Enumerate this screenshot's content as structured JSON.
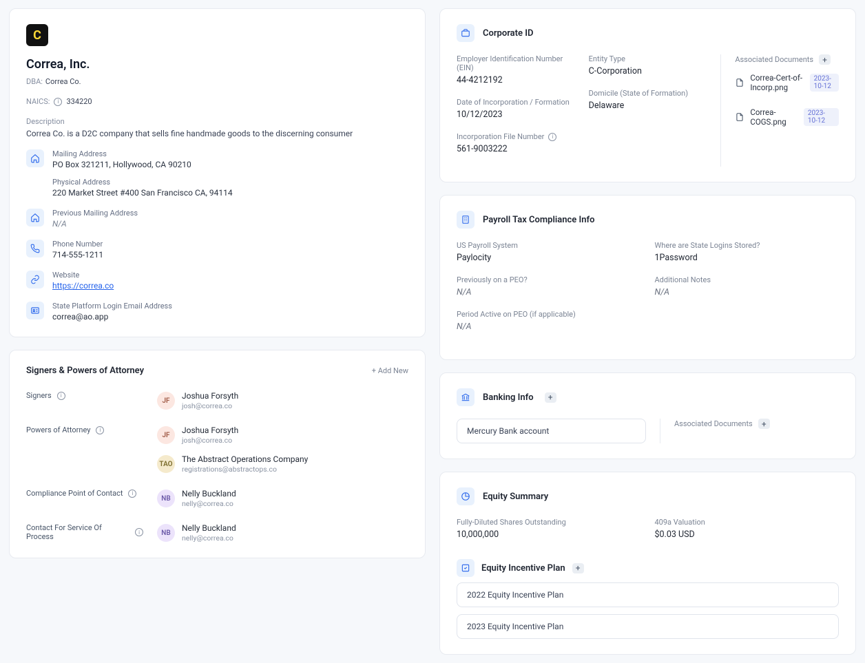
{
  "company": {
    "name": "Correa, Inc.",
    "dba_label": "DBA:",
    "dba_value": "Correa Co.",
    "naics_label": "NAICS:",
    "naics_value": "334220",
    "description_label": "Description",
    "description": "Correa Co. is a D2C company that sells fine handmade goods to the discerning consumer",
    "mailing": {
      "label": "Mailing Address",
      "value": "PO Box 321211, Hollywood, CA 90210"
    },
    "physical": {
      "label": "Physical Address",
      "value": "220 Market Street #400 San Francisco CA, 94114"
    },
    "prev_mailing": {
      "label": "Previous Mailing Address",
      "value": "N/A"
    },
    "phone": {
      "label": "Phone Number",
      "value": "714-555-1211"
    },
    "website": {
      "label": "Website",
      "value": "https://correa.co"
    },
    "login_email": {
      "label": "State Platform Login Email Address",
      "value": "correa@ao.app"
    }
  },
  "signers": {
    "title": "Signers & Powers of Attorney",
    "add_new": "+ Add New",
    "groups": [
      {
        "label": "Signers",
        "people": [
          {
            "initials": "JF",
            "color": "pink",
            "name": "Joshua Forsyth",
            "email": "josh@correa.co"
          }
        ]
      },
      {
        "label": "Powers of Attorney",
        "people": [
          {
            "initials": "JF",
            "color": "pink",
            "name": "Joshua Forsyth",
            "email": "josh@correa.co"
          },
          {
            "initials": "TAO",
            "color": "yellow",
            "name": "The Abstract Operations Company",
            "email": "registrations@abstractops.co"
          }
        ]
      },
      {
        "label": "Compliance Point of Contact",
        "people": [
          {
            "initials": "NB",
            "color": "purple",
            "name": "Nelly Buckland",
            "email": "nelly@correa.co"
          }
        ]
      },
      {
        "label": "Contact For Service Of Process",
        "people": [
          {
            "initials": "NB",
            "color": "purple",
            "name": "Nelly Buckland",
            "email": "nelly@correa.co"
          }
        ]
      }
    ]
  },
  "corporate": {
    "title": "Corporate ID",
    "ein": {
      "label": "Employer Identification Number (EIN)",
      "value": "44-4212192"
    },
    "entity": {
      "label": "Entity Type",
      "value": "C-Corporation"
    },
    "incorp_date": {
      "label": "Date of Incorporation / Formation",
      "value": "10/12/2023"
    },
    "domicile": {
      "label": "Domicile (State of Formation)",
      "value": "Delaware"
    },
    "file_no": {
      "label": "Incorporation File Number",
      "value": "561-9003222"
    },
    "assoc_label": "Associated Documents",
    "docs": [
      {
        "name": "Correa-Cert-of-Incorp.png",
        "date": "2023-10-12"
      },
      {
        "name": "Correa-COGS.png",
        "date": "2023-10-12"
      }
    ]
  },
  "payroll": {
    "title": "Payroll Tax Compliance Info",
    "system": {
      "label": "US Payroll System",
      "value": "Paylocity"
    },
    "logins": {
      "label": "Where are State Logins Stored?",
      "value": "1Password"
    },
    "peo": {
      "label": "Previously on a PEO?",
      "value": "N/A"
    },
    "notes": {
      "label": "Additional Notes",
      "value": "N/A"
    },
    "period": {
      "label": "Period Active on PEO (if applicable)",
      "value": "N/A"
    }
  },
  "banking": {
    "title": "Banking Info",
    "account": "Mercury Bank account",
    "assoc_label": "Associated Documents"
  },
  "equity": {
    "title": "Equity Summary",
    "shares": {
      "label": "Fully-Diluted Shares Outstanding",
      "value": "10,000,000"
    },
    "val": {
      "label": "409a Valuation",
      "value": "$0.03 USD"
    },
    "plan_title": "Equity Incentive Plan",
    "plans": [
      "2022 Equity Incentive Plan",
      "2023 Equity Incentive Plan"
    ]
  }
}
